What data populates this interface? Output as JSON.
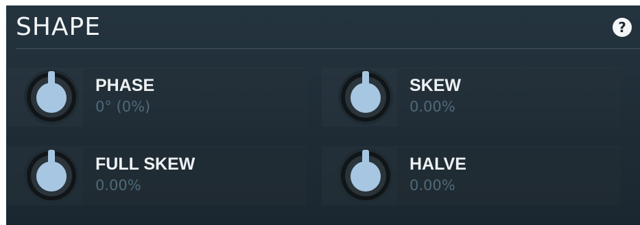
{
  "section": {
    "title": "SHAPE",
    "help_label": "?"
  },
  "controls": [
    {
      "label": "PHASE",
      "value": "0° (0%)",
      "level": 0.5
    },
    {
      "label": "SKEW",
      "value": "0.00%",
      "level": 0.5
    },
    {
      "label": "FULL SKEW",
      "value": "0.00%",
      "level": 0.5
    },
    {
      "label": "HALVE",
      "value": "0.00%",
      "level": 0.5
    }
  ],
  "colors": {
    "panel": "#22323d",
    "knob_cap": "#a7c6e2",
    "knob_body": "#111518",
    "label": "#eef1f3",
    "value": "#4f6a79"
  }
}
